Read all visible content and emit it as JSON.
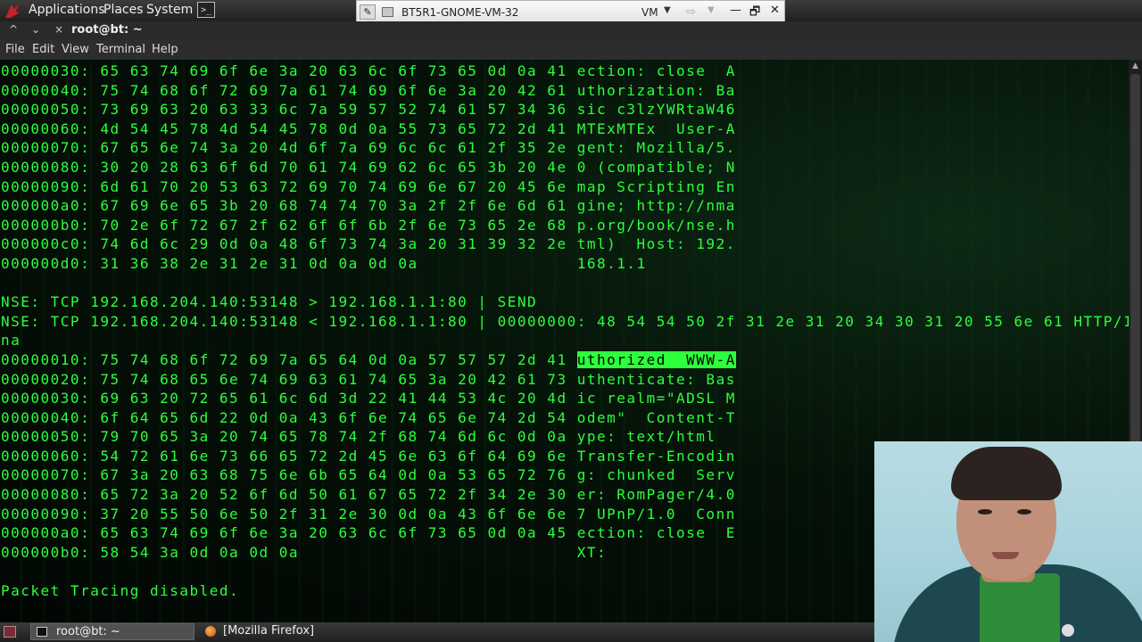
{
  "top_panel": {
    "applications": "Applications",
    "places": "Places",
    "system": "System",
    "launcher_icon": "terminal-launcher-icon",
    "logo_icon": "backtrack-dragon-logo"
  },
  "vm_toolbar": {
    "title": "BT5R1-GNOME-VM-32",
    "menu_label": "VM",
    "pin_icon": "pin-icon",
    "send_icon": "send-keys-icon",
    "minimize": "—",
    "restore": "🗗",
    "close": "✕"
  },
  "window": {
    "title": "root@bt: ~",
    "controls": [
      "^",
      "⌄",
      "×"
    ]
  },
  "menu": [
    "File",
    "Edit",
    "View",
    "Terminal",
    "Help"
  ],
  "terminal": {
    "highlight_color": "#2dff3c",
    "text_color": "#2dff3c",
    "lines": [
      "00000030: 65 63 74 69 6f 6e 3a 20 63 6c 6f 73 65 0d 0a 41 ection: close  A",
      "00000040: 75 74 68 6f 72 69 7a 61 74 69 6f 6e 3a 20 42 61 uthorization: Ba",
      "00000050: 73 69 63 20 63 33 6c 7a 59 57 52 74 61 57 34 36 sic c3lzYWRtaW46",
      "00000060: 4d 54 45 78 4d 54 45 78 0d 0a 55 73 65 72 2d 41 MTExMTEx  User-A",
      "00000070: 67 65 6e 74 3a 20 4d 6f 7a 69 6c 6c 61 2f 35 2e gent: Mozilla/5.",
      "00000080: 30 20 28 63 6f 6d 70 61 74 69 62 6c 65 3b 20 4e 0 (compatible; N",
      "00000090: 6d 61 70 20 53 63 72 69 70 74 69 6e 67 20 45 6e map Scripting En",
      "000000a0: 67 69 6e 65 3b 20 68 74 74 70 3a 2f 2f 6e 6d 61 gine; http://nma",
      "000000b0: 70 2e 6f 72 67 2f 62 6f 6f 6b 2f 6e 73 65 2e 68 p.org/book/nse.h",
      "000000c0: 74 6d 6c 29 0d 0a 48 6f 73 74 3a 20 31 39 32 2e tml)  Host: 192.",
      "000000d0: 31 36 38 2e 31 2e 31 0d 0a 0d 0a                168.1.1",
      "",
      "NSE: TCP 192.168.204.140:53148 > 192.168.1.1:80 | SEND",
      "NSE: TCP 192.168.204.140:53148 < 192.168.1.1:80 | 00000000: 48 54 54 50 2f 31 2e 31 20 34 30 31 20 55 6e 61 HTTP/1.1 401 U",
      "na",
      "00000020: 75 74 68 65 6e 74 69 63 61 74 65 3a 20 42 61 73 uthenticate: Bas",
      "00000030: 69 63 20 72 65 61 6c 6d 3d 22 41 44 53 4c 20 4d ic realm=\"ADSL M",
      "00000040: 6f 64 65 6d 22 0d 0a 43 6f 6e 74 65 6e 74 2d 54 odem\"  Content-T",
      "00000050: 79 70 65 3a 20 74 65 78 74 2f 68 74 6d 6c 0d 0a ype: text/html",
      "00000060: 54 72 61 6e 73 66 65 72 2d 45 6e 63 6f 64 69 6e Transfer-Encodin",
      "00000070: 67 3a 20 63 68 75 6e 6b 65 64 0d 0a 53 65 72 76 g: chunked  Serv",
      "00000080: 65 72 3a 20 52 6f 6d 50 61 67 65 72 2f 34 2e 30 er: RomPager/4.0",
      "00000090: 37 20 55 50 6e 50 2f 31 2e 30 0d 0a 43 6f 6e 6e 7 UPnP/1.0  Conn",
      "000000a0: 65 63 74 69 6f 6e 3a 20 63 6c 6f 73 65 0d 0a 45 ection: close  E",
      "000000b0: 58 54 3a 0d 0a 0d 0a                            XT:",
      "",
      "Packet Tracing disabled."
    ],
    "selected_line": {
      "prefix": "00000010: 75 74 68 6f 72 69 7a 65 64 0d 0a 57 57 57 2d 41 ",
      "selection": "uthorized  WWW-A"
    }
  },
  "taskbar": {
    "terminal_task": "root@bt: ~",
    "firefox_task": "[Mozilla Firefox]"
  },
  "webcam": {
    "description_icon": "presenter-webcam-feed"
  }
}
